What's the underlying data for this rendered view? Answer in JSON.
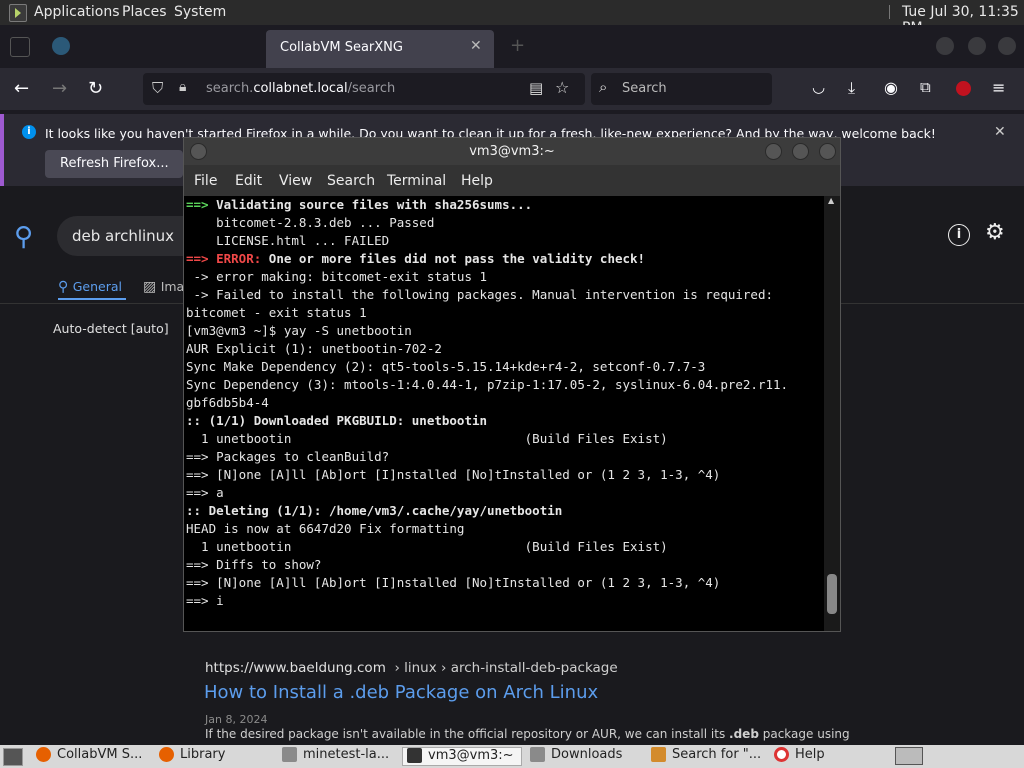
{
  "top_panel": {
    "menus": [
      "Applications",
      "Places",
      "System"
    ],
    "clock": "Tue Jul 30, 11:35 PM"
  },
  "browser": {
    "tab_inactive": "",
    "tab_active": "CollabVM SearXNG",
    "url_prefix": "search.",
    "url_domain": "collabnet.local",
    "url_path": "/search",
    "search_placeholder": "Search",
    "notification_text": "It looks like you haven't started Firefox in a while. Do you want to clean it up for a fresh, like-new experience? And by the way, welcome back!",
    "refresh_button": "Refresh Firefox..."
  },
  "page": {
    "query": "deb archlinux",
    "tab_general": "General",
    "tab_images": "Ima",
    "autodetect": "Auto-detect [auto]",
    "result": {
      "domain": "https://www.baeldung.com",
      "path": "› linux › arch-install-deb-package",
      "title": "How to Install a .deb Package on Arch Linux",
      "date": "Jan 8, 2024",
      "snippet_pre": "If the desired package isn't available in the official repository or AUR, we can install its ",
      "snippet_bold": ".deb",
      "snippet_post": " package using"
    }
  },
  "terminal": {
    "title": "vm3@vm3:~",
    "menu": [
      "File",
      "Edit",
      "View",
      "Search",
      "Terminal",
      "Help"
    ],
    "lines": [
      {
        "p": "==> ",
        "pc": "green",
        "t": "Validating source files with sha256sums...",
        "tc": "bold"
      },
      {
        "t": "    bitcomet-2.8.3.deb ... Passed"
      },
      {
        "t": "    LICENSE.html ... FAILED"
      },
      {
        "p": "==> ",
        "pc": "red",
        "m": "ERROR:",
        "mc": "red",
        "t": " One or more files did not pass the validity check!",
        "tc": "bold"
      },
      {
        "t": " -> error making: bitcomet-exit status 1"
      },
      {
        "t": " -> Failed to install the following packages. Manual intervention is required:"
      },
      {
        "t": "bitcomet - exit status 1"
      },
      {
        "t": "[vm3@vm3 ~]$ yay -S unetbootin"
      },
      {
        "t": "AUR Explicit (1): unetbootin-702-2"
      },
      {
        "t": "Sync Make Dependency (2): qt5-tools-5.15.14+kde+r4-2, setconf-0.7.7-3"
      },
      {
        "t": "Sync Dependency (3): mtools-1:4.0.44-1, p7zip-1:17.05-2, syslinux-6.04.pre2.r11."
      },
      {
        "t": "gbf6db5b4-4"
      },
      {
        "t": ":: (1/1) Downloaded PKGBUILD: unetbootin",
        "tc": "bold"
      },
      {
        "t": "  1 unetbootin                               (Build Files Exist)"
      },
      {
        "t": "==> Packages to cleanBuild?"
      },
      {
        "t": "==> [N]one [A]ll [Ab]ort [I]nstalled [No]tInstalled or (1 2 3, 1-3, ^4)"
      },
      {
        "t": "==> a"
      },
      {
        "t": ":: Deleting (1/1): /home/vm3/.cache/yay/unetbootin",
        "tc": "bold"
      },
      {
        "t": "HEAD is now at 6647d20 Fix formatting"
      },
      {
        "t": "  1 unetbootin                               (Build Files Exist)"
      },
      {
        "t": "==> Diffs to show?"
      },
      {
        "t": "==> [N]one [A]ll [Ab]ort [I]nstalled [No]tInstalled or (1 2 3, 1-3, ^4)"
      },
      {
        "t": "==> i"
      }
    ]
  },
  "taskbar": {
    "items": [
      {
        "label": "CollabVM S...",
        "icon": "firefox-icon"
      },
      {
        "label": "Library",
        "icon": "firefox-icon"
      },
      {
        "label": "minetest-la...",
        "icon": "folder-icon"
      },
      {
        "label": "vm3@vm3:~",
        "icon": "terminal-icon"
      },
      {
        "label": "Downloads",
        "icon": "folder-icon"
      },
      {
        "label": "Search for \"...",
        "icon": "search-folder-icon"
      },
      {
        "label": "Help",
        "icon": "help-icon"
      }
    ]
  }
}
